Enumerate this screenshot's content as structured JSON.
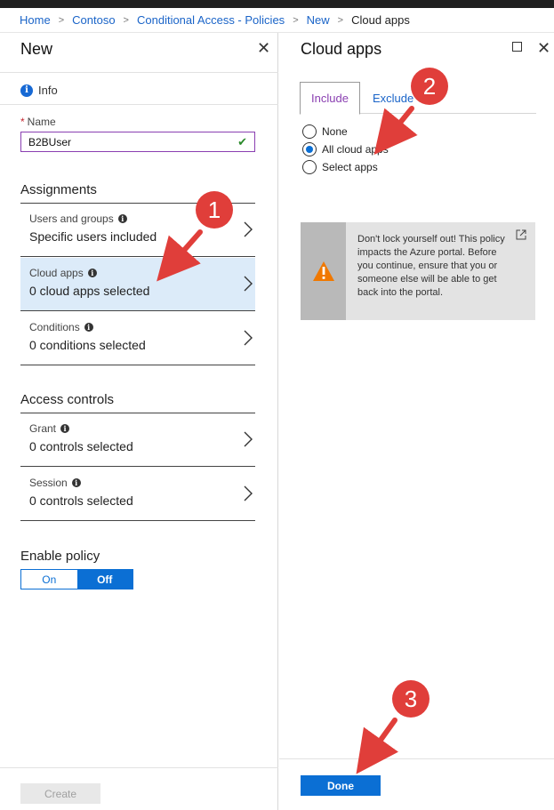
{
  "breadcrumb": [
    "Home",
    "Contoso",
    "Conditional Access - Policies",
    "New",
    "Cloud apps"
  ],
  "left_pane": {
    "title": "New",
    "info_label": "Info",
    "name_label": "Name",
    "name_value": "B2BUser",
    "assignments_title": "Assignments",
    "assignments": [
      {
        "label": "Users and groups",
        "value": "Specific users included"
      },
      {
        "label": "Cloud apps",
        "value": "0 cloud apps selected"
      },
      {
        "label": "Conditions",
        "value": "0 conditions selected"
      }
    ],
    "access_controls_title": "Access controls",
    "access_controls": [
      {
        "label": "Grant",
        "value": "0 controls selected"
      },
      {
        "label": "Session",
        "value": "0 controls selected"
      }
    ],
    "enable_policy_title": "Enable policy",
    "toggle_on": "On",
    "toggle_off": "Off",
    "create_label": "Create"
  },
  "right_pane": {
    "title": "Cloud apps",
    "tabs": [
      "Include",
      "Exclude"
    ],
    "radios": [
      {
        "label": "None",
        "selected": false
      },
      {
        "label": "All cloud apps",
        "selected": true
      },
      {
        "label": "Select apps",
        "selected": false
      }
    ],
    "warning_text": "Don't lock yourself out! This policy impacts the Azure portal. Before you continue, ensure that you or someone else will be able to get back into the portal.",
    "done_label": "Done"
  },
  "annotations": [
    "1",
    "2",
    "3"
  ],
  "colors": {
    "accent": "#0b6fd4",
    "link": "#1a64c8",
    "selected_row": "#dcebf9",
    "annotation_red": "#e03e3a",
    "warning_orange": "#f07800",
    "name_border": "#8a3fb1"
  }
}
